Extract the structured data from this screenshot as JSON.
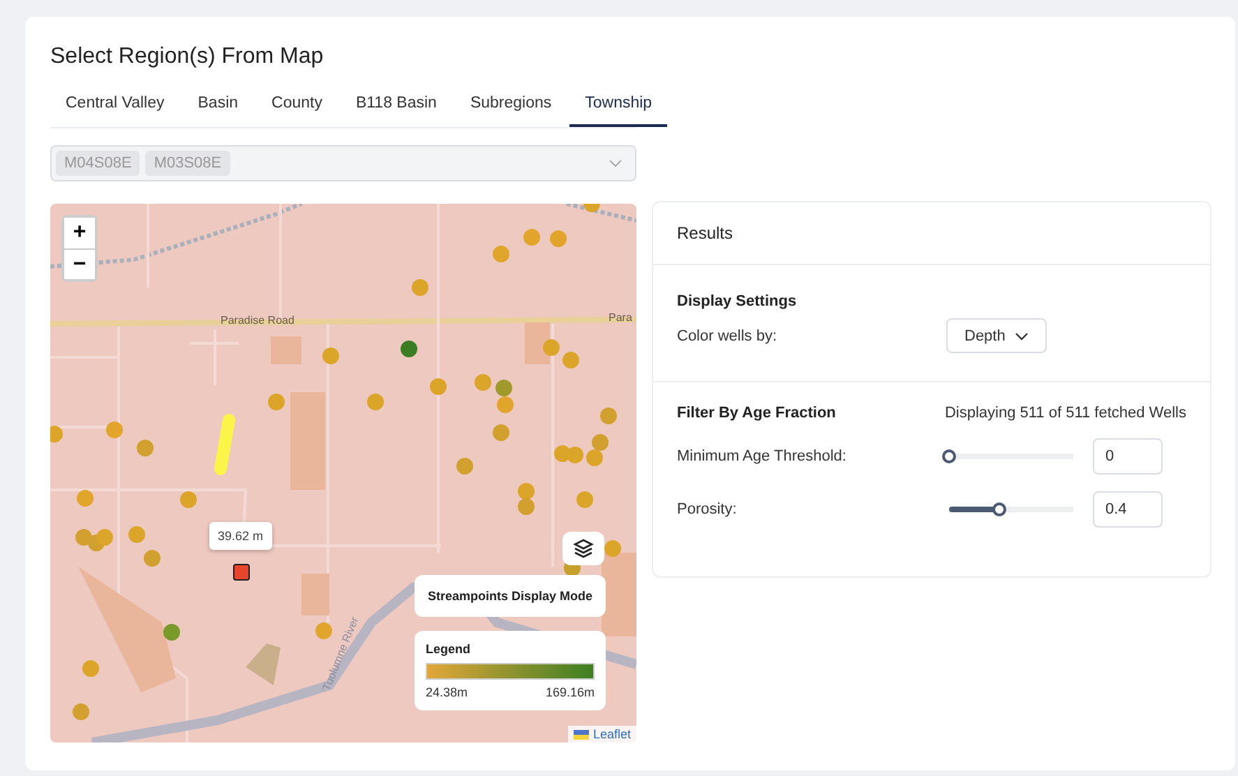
{
  "title": "Select Region(s) From Map",
  "tabs": [
    {
      "label": "Central Valley",
      "selected": false
    },
    {
      "label": "Basin",
      "selected": false
    },
    {
      "label": "County",
      "selected": false
    },
    {
      "label": "B118 Basin",
      "selected": false
    },
    {
      "label": "Subregions",
      "selected": false
    },
    {
      "label": "Township",
      "selected": true
    }
  ],
  "region_select": {
    "tags": [
      "M04S08E",
      "M03S08E"
    ],
    "disabled": true
  },
  "map": {
    "zoom_in": "+",
    "zoom_out": "−",
    "road_labels": [
      "Paradise Road",
      "Para"
    ],
    "river_label": "Tuolumne River",
    "tooltip": "39.62 m",
    "display_mode_button": "Streampoints Display Mode",
    "legend": {
      "title": "Legend",
      "min": "24.38m",
      "max": "169.16m"
    },
    "attribution": "Leaflet"
  },
  "results": {
    "title": "Results",
    "display_settings": {
      "heading": "Display Settings",
      "label": "Color wells by:",
      "value": "Depth"
    },
    "filter": {
      "heading": "Filter By Age Fraction",
      "count": "Displaying 511 of 511 fetched Wells",
      "sliders": [
        {
          "label": "Minimum Age Threshold:",
          "level": 0,
          "value": "0"
        },
        {
          "label": "Porosity:",
          "level": 0.4,
          "value": "0.4"
        }
      ]
    }
  }
}
